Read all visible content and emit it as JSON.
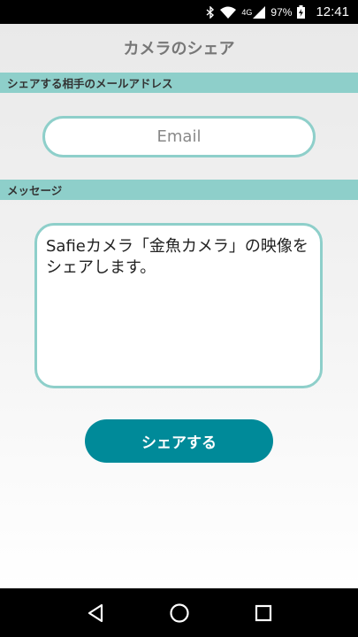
{
  "status_bar": {
    "network": "4G",
    "battery": "97%",
    "time": "12:41",
    "icons": [
      "bluetooth-icon",
      "wifi-icon",
      "signal-icon",
      "battery-charging-icon"
    ]
  },
  "header": {
    "title": "カメラのシェア"
  },
  "email_section": {
    "label": "シェアする相手のメールアドレス",
    "placeholder": "Email",
    "value": ""
  },
  "message_section": {
    "label": "メッセージ",
    "value": "Safieカメラ「金魚カメラ」の映像をシェアします。"
  },
  "actions": {
    "share_label": "シェアする"
  },
  "nav_bar": {
    "icons": [
      "back-icon",
      "home-icon",
      "recents-icon"
    ]
  },
  "colors": {
    "accent": "#8ecfca",
    "button": "#008a99",
    "title": "#777777"
  }
}
